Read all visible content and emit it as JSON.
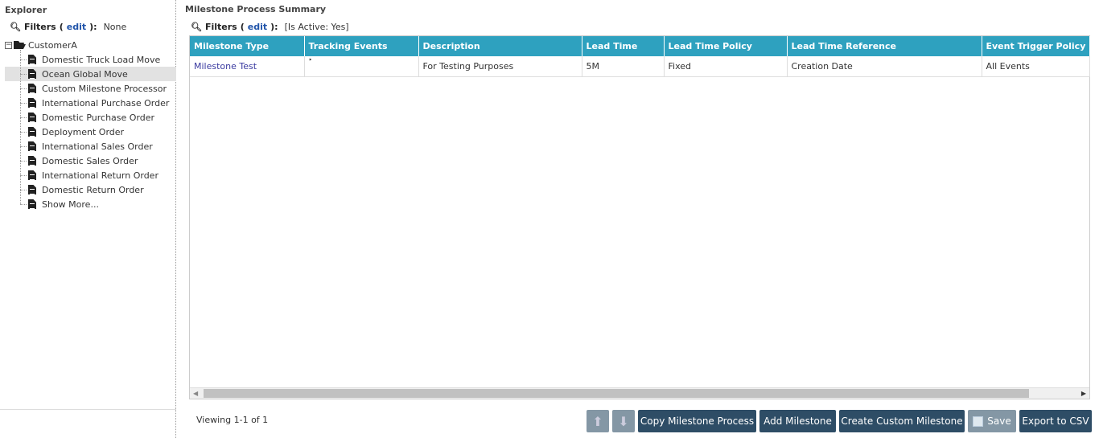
{
  "explorer": {
    "title": "Explorer",
    "filters_label": "Filters",
    "edit": "edit",
    "filters_value": "None",
    "root": "CustomerA",
    "items": [
      "Domestic Truck Load Move",
      "Ocean Global Move",
      "Custom Milestone Processor",
      "International Purchase Order",
      "Domestic Purchase Order",
      "Deployment Order",
      "International Sales Order",
      "Domestic Sales Order",
      "International Return Order",
      "Domestic Return Order",
      "Show More..."
    ],
    "selected_index": 1
  },
  "main": {
    "title": "Milestone Process Summary",
    "filters_label": "Filters",
    "edit": "edit",
    "filters_value": "[Is Active: Yes]",
    "columns": [
      "Milestone Type",
      "Tracking Events",
      "Description",
      "Lead Time",
      "Lead Time Policy",
      "Lead Time Reference",
      "Event Trigger Policy"
    ],
    "rows": [
      [
        "Milestone Test",
        "‣",
        "For Testing Purposes",
        "5M",
        "Fixed",
        "Creation Date",
        "All Events"
      ]
    ],
    "viewing": "Viewing 1-1 of 1"
  },
  "buttons": {
    "copy": "Copy Milestone Process",
    "add": "Add Milestone",
    "create": "Create Custom Milestone",
    "save": "Save",
    "export": "Export to CSV"
  }
}
